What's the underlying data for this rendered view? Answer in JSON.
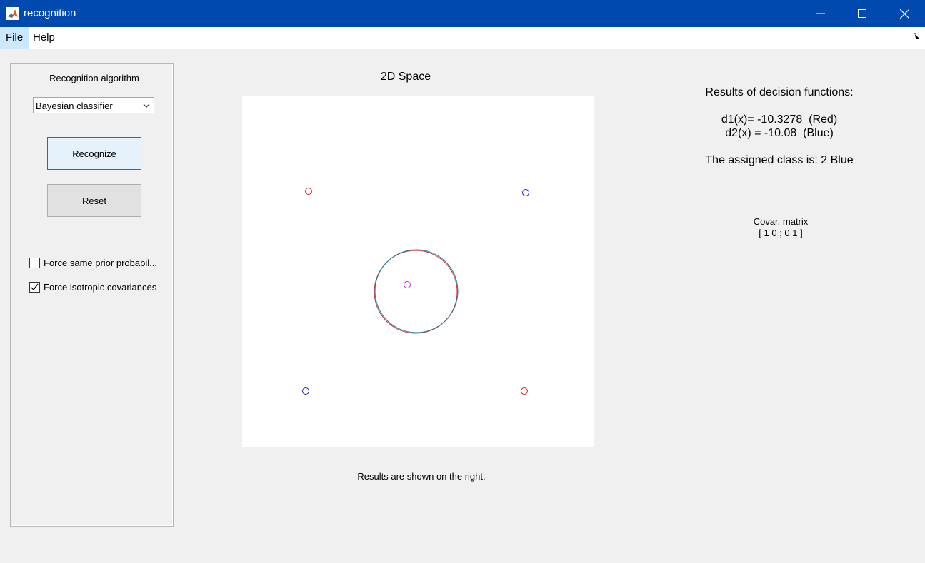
{
  "window": {
    "title": "recognition",
    "icon": "matlab-icon"
  },
  "menu": {
    "items": [
      "File",
      "Help"
    ]
  },
  "controls": {
    "algorithm_label": "Recognition algorithm",
    "algorithm_selected": "Bayesian classifier",
    "recognize_label": "Recognize",
    "reset_label": "Reset",
    "checkboxes": [
      {
        "label": "Force same prior probabil...",
        "checked": false
      },
      {
        "label": "Force isotropic covariances",
        "checked": true
      }
    ]
  },
  "plot": {
    "title": "2D Space",
    "status": "Results are shown on the right."
  },
  "results": {
    "header": "Results of decision functions:",
    "d1": "d1(x)= -10.3278  (Red)",
    "d2": "d2(x) = -10.08  (Blue)",
    "assigned": "The assigned class is: 2 Blue",
    "cov_label": "Covar. matrix",
    "cov_value": "[ 1 0 ; 0 1 ]"
  },
  "colors": {
    "titlebar": "#0049af",
    "class_red": "#e02020",
    "class_blue": "#2020c0",
    "test_point": "#e020e0",
    "circle_teal": "#1a7fa0"
  }
}
